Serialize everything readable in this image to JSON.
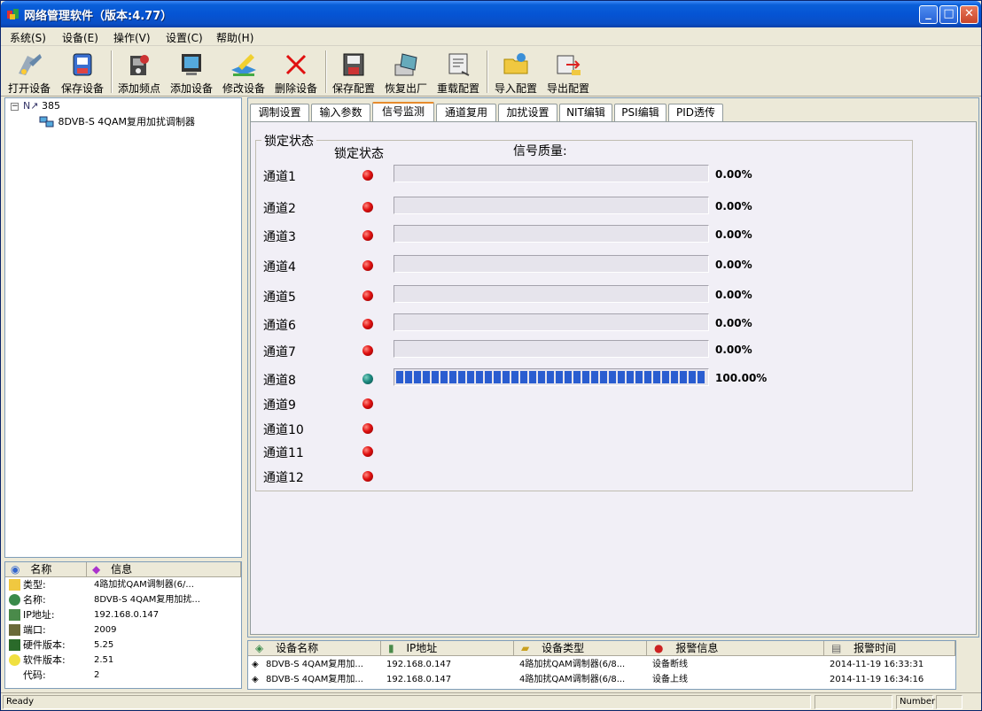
{
  "window": {
    "title": "网络管理软件（版本:4.77）"
  },
  "menu": [
    {
      "label": "系统(S)"
    },
    {
      "label": "设备(E)"
    },
    {
      "label": "操作(V)"
    },
    {
      "label": "设置(C)"
    },
    {
      "label": "帮助(H)"
    }
  ],
  "toolbar": [
    {
      "label": "打开设备",
      "icon": "open-device-icon"
    },
    {
      "label": "保存设备",
      "icon": "save-device-icon"
    },
    {
      "label": "添加频点",
      "icon": "add-frequency-icon"
    },
    {
      "label": "添加设备",
      "icon": "add-device-icon"
    },
    {
      "label": "修改设备",
      "icon": "edit-device-icon"
    },
    {
      "label": "删除设备",
      "icon": "delete-device-icon"
    },
    {
      "label": "保存配置",
      "icon": "save-config-icon"
    },
    {
      "label": "恢复出厂",
      "icon": "factory-reset-icon"
    },
    {
      "label": "重载配置",
      "icon": "reload-config-icon"
    },
    {
      "label": "导入配置",
      "icon": "import-config-icon"
    },
    {
      "label": "导出配置",
      "icon": "export-config-icon"
    }
  ],
  "tree": {
    "root": "385",
    "child": "8DVB-S 4QAM复用加扰调制器"
  },
  "properties": {
    "headers": {
      "name": "名称",
      "info": "信息"
    },
    "rows": [
      {
        "name": "类型:",
        "value": "4路加扰QAM调制器(6/..."
      },
      {
        "name": "名称:",
        "value": "8DVB-S 4QAM复用加扰..."
      },
      {
        "name": "IP地址:",
        "value": "192.168.0.147"
      },
      {
        "name": "端口:",
        "value": "2009"
      },
      {
        "name": "硬件版本:",
        "value": "5.25"
      },
      {
        "name": "软件版本:",
        "value": "2.51"
      },
      {
        "name": "代码:",
        "value": "2"
      }
    ]
  },
  "tabs": [
    {
      "label": "调制设置",
      "active": false
    },
    {
      "label": "输入参数",
      "active": false
    },
    {
      "label": "信号监测",
      "active": true
    },
    {
      "label": "通道复用",
      "active": false
    },
    {
      "label": "加扰设置",
      "active": false
    },
    {
      "label": "NIT编辑",
      "active": false
    },
    {
      "label": "PSI编辑",
      "active": false
    },
    {
      "label": "PID透传",
      "active": false
    }
  ],
  "monitor": {
    "group_title": "锁定状态",
    "col_lock": "锁定状态",
    "col_quality": "信号质量:",
    "channels": [
      {
        "name": "通道1",
        "locked": false,
        "quality": 0,
        "label": "0.00%"
      },
      {
        "name": "通道2",
        "locked": false,
        "quality": 0,
        "label": "0.00%"
      },
      {
        "name": "通道3",
        "locked": false,
        "quality": 0,
        "label": "0.00%"
      },
      {
        "name": "通道4",
        "locked": false,
        "quality": 0,
        "label": "0.00%"
      },
      {
        "name": "通道5",
        "locked": false,
        "quality": 0,
        "label": "0.00%"
      },
      {
        "name": "通道6",
        "locked": false,
        "quality": 0,
        "label": "0.00%"
      },
      {
        "name": "通道7",
        "locked": false,
        "quality": 0,
        "label": "0.00%"
      },
      {
        "name": "通道8",
        "locked": true,
        "quality": 100,
        "label": "100.00%"
      },
      {
        "name": "通道9",
        "locked": false
      },
      {
        "name": "通道10",
        "locked": false
      },
      {
        "name": "通道11",
        "locked": false
      },
      {
        "name": "通道12",
        "locked": false
      }
    ]
  },
  "log": {
    "headers": [
      "设备名称",
      "IP地址",
      "设备类型",
      "报警信息",
      "报警时间"
    ],
    "rows": [
      [
        "8DVB-S 4QAM复用加...",
        "192.168.0.147",
        "4路加扰QAM调制器(6/8...",
        "设备断线",
        "2014-11-19 16:33:31"
      ],
      [
        "8DVB-S 4QAM复用加...",
        "192.168.0.147",
        "4路加扰QAM调制器(6/8...",
        "设备上线",
        "2014-11-19 16:34:16"
      ]
    ]
  },
  "status": {
    "left": "Ready",
    "number": "Number"
  },
  "colors": {
    "lock_off": "#e01010",
    "lock_on": "#1d8a80",
    "bar_fill": "#2a5dd0",
    "title_bar": "#0554d4"
  }
}
